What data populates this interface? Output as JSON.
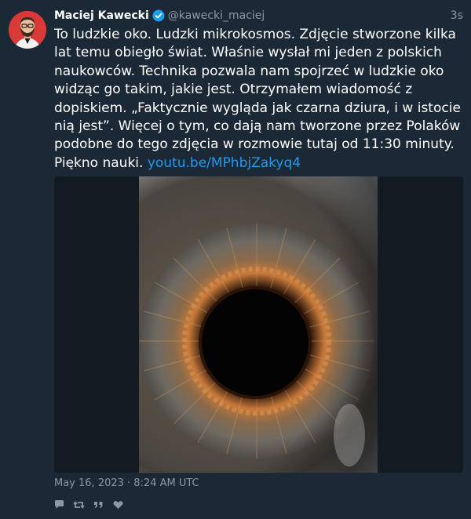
{
  "tweet": {
    "display_name": "Maciej Kawecki",
    "handle": "@kawecki_maciej",
    "time_ago": "3s",
    "text": "To ludzkie oko. Ludzki mikrokosmos. Zdjęcie stworzone kilka lat temu obiegło świat. Właśnie wysłał mi jeden z polskich naukowców. Technika pozwala nam spojrzeć w ludzkie oko widząc go takim, jakie jest. Otrzymałem wiadomość z dopiskiem. „Faktycznie wygląda jak czarna dziura, i w istocie nią jest”. Więcej o tym, co dają nam tworzone przez Polaków podobne do tego zdjęcia w rozmowie tutaj od 11:30 minuty. Piękno nauki. ",
    "link_text": "youtu.be/MPhbjZakyq4",
    "timestamp": "May 16, 2023 · 8:24 AM UTC"
  },
  "icons": {
    "verified": "verified-badge-icon",
    "actions": [
      "reply-icon",
      "retweet-icon",
      "quote-icon",
      "like-icon"
    ]
  },
  "colors": {
    "background": "#1b2836",
    "text": "#ffffff",
    "secondary_text": "#8b98a5",
    "link": "#1d9bf0",
    "verified": "#1d9bf0"
  }
}
